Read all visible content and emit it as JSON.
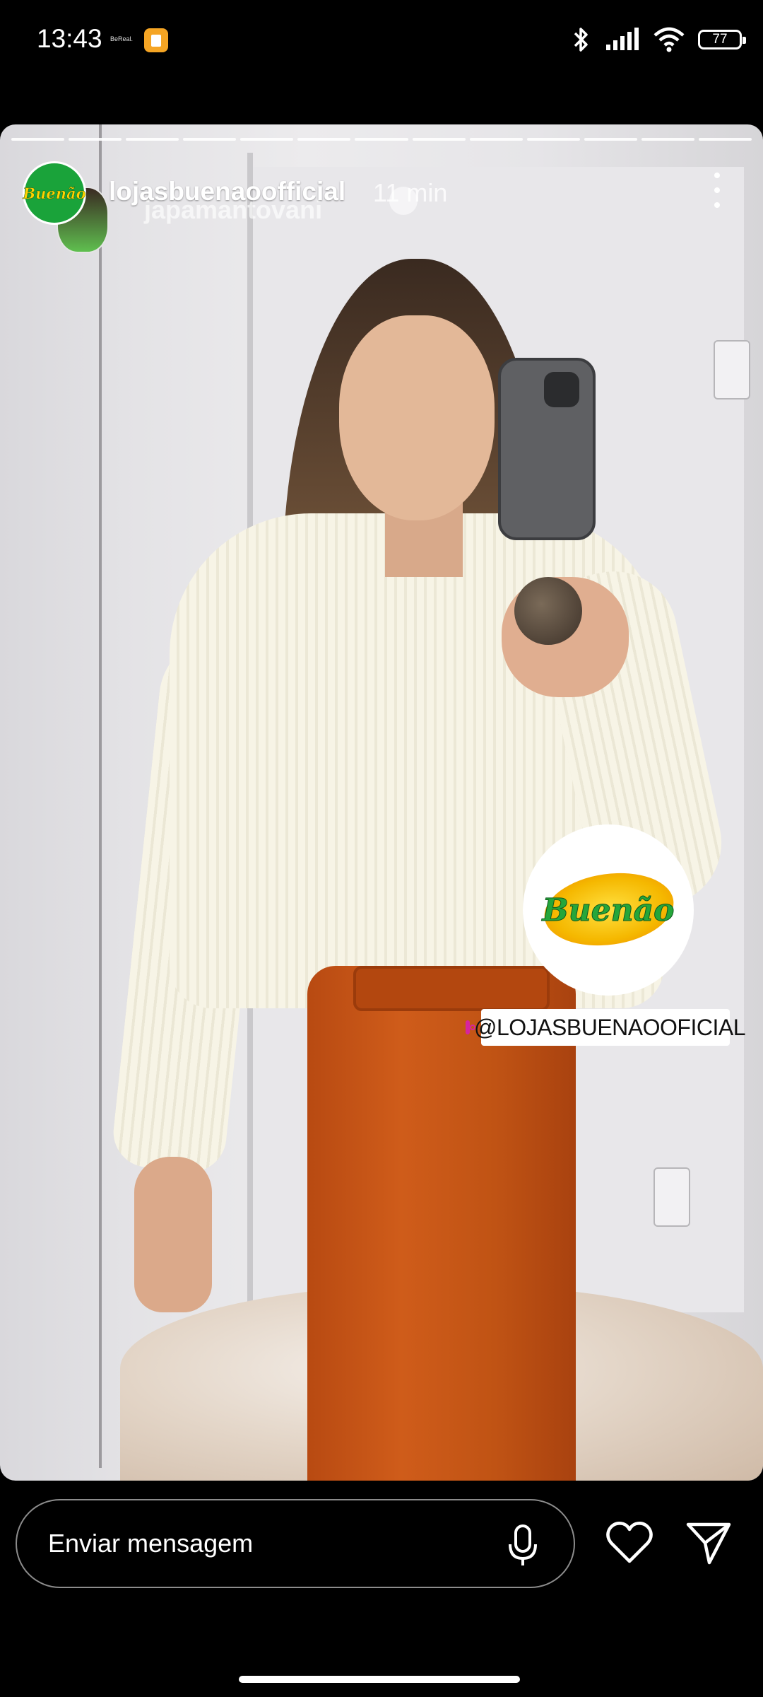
{
  "status_bar": {
    "time": "13:43",
    "notification_text": "BeReal.",
    "battery": "77",
    "icons": [
      "app-notification-icon",
      "bluetooth-icon",
      "signal-icon",
      "wifi-icon",
      "battery-icon"
    ]
  },
  "story": {
    "segments": 13,
    "username": "lojasbuenaoofficial",
    "time_ago": "11 min",
    "reposted_tag": "japamantovani",
    "sticker": {
      "brand": "Buenão",
      "handle": "@LOJASBUENAOOFICIAL"
    }
  },
  "reply_bar": {
    "placeholder": "Enviar mensagem"
  },
  "colors": {
    "background": "#000000",
    "brand_green": "#1aa33a",
    "brand_yellow": "#ffd200",
    "pants_orange": "#c6561a"
  }
}
